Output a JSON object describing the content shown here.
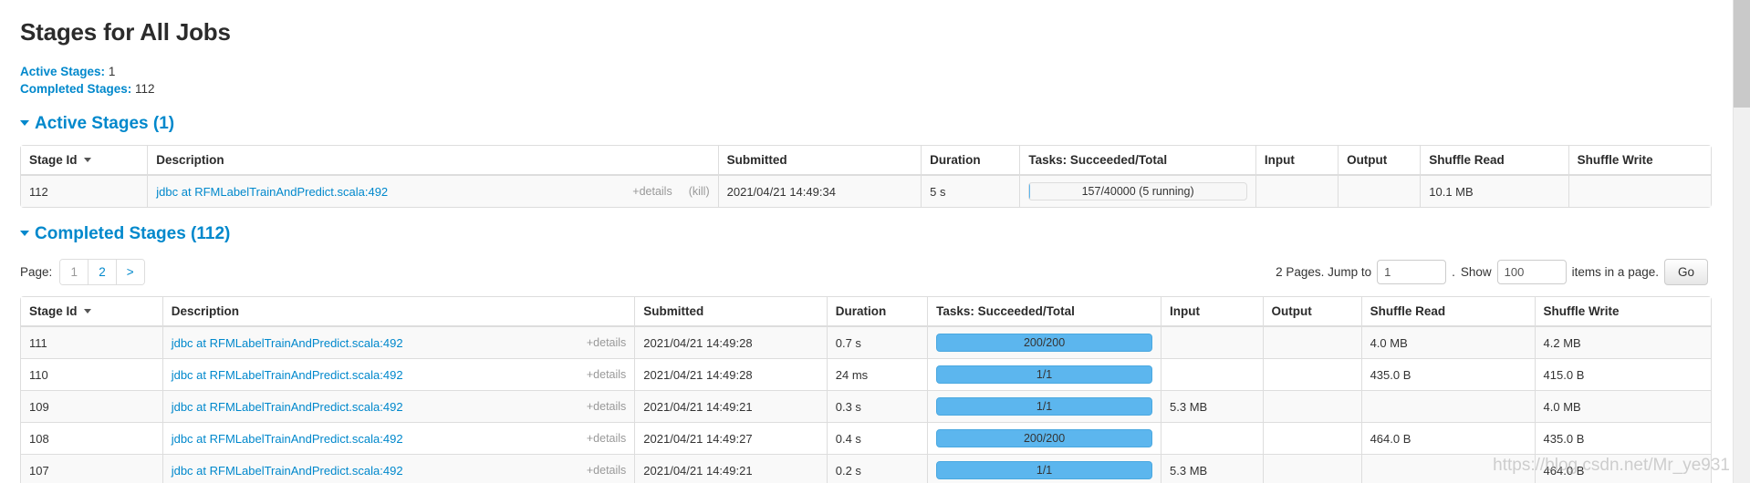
{
  "page": {
    "title": "Stages for All Jobs",
    "summary": [
      {
        "label": "Active Stages:",
        "value": "1"
      },
      {
        "label": "Completed Stages:",
        "value": "112"
      }
    ]
  },
  "active_section": {
    "header": "Active Stages (1)",
    "columns": [
      "Stage Id",
      "Description",
      "Submitted",
      "Duration",
      "Tasks: Succeeded/Total",
      "Input",
      "Output",
      "Shuffle Read",
      "Shuffle Write"
    ],
    "rows": [
      {
        "stage_id": "112",
        "description": "jdbc at RFMLabelTrainAndPredict.scala:492",
        "details_label": "+details",
        "kill_label": "(kill)",
        "submitted": "2021/04/21 14:49:34",
        "duration": "5 s",
        "tasks_label": "157/40000 (5 running)",
        "tasks_percent": 0.4,
        "tasks_complete": false,
        "input": "",
        "output": "",
        "shuffle_read": "10.1 MB",
        "shuffle_write": ""
      }
    ]
  },
  "completed_section": {
    "header": "Completed Stages (112)",
    "pager": {
      "page_label": "Page:",
      "pages": [
        "1",
        "2",
        ">"
      ],
      "current_page": "1",
      "pages_info": "2 Pages. Jump to",
      "jump_value": "1",
      "separator": ".",
      "show_label": "Show",
      "show_value": "100",
      "items_label": "items in a page.",
      "go_label": "Go"
    },
    "columns": [
      "Stage Id",
      "Description",
      "Submitted",
      "Duration",
      "Tasks: Succeeded/Total",
      "Input",
      "Output",
      "Shuffle Read",
      "Shuffle Write"
    ],
    "rows": [
      {
        "stage_id": "111",
        "description": "jdbc at RFMLabelTrainAndPredict.scala:492",
        "details_label": "+details",
        "submitted": "2021/04/21 14:49:28",
        "duration": "0.7 s",
        "tasks_label": "200/200",
        "tasks_complete": true,
        "input": "",
        "output": "",
        "shuffle_read": "4.0 MB",
        "shuffle_write": "4.2 MB"
      },
      {
        "stage_id": "110",
        "description": "jdbc at RFMLabelTrainAndPredict.scala:492",
        "details_label": "+details",
        "submitted": "2021/04/21 14:49:28",
        "duration": "24 ms",
        "tasks_label": "1/1",
        "tasks_complete": true,
        "input": "",
        "output": "",
        "shuffle_read": "435.0 B",
        "shuffle_write": "415.0 B"
      },
      {
        "stage_id": "109",
        "description": "jdbc at RFMLabelTrainAndPredict.scala:492",
        "details_label": "+details",
        "submitted": "2021/04/21 14:49:21",
        "duration": "0.3 s",
        "tasks_label": "1/1",
        "tasks_complete": true,
        "input": "5.3 MB",
        "output": "",
        "shuffle_read": "",
        "shuffle_write": "4.0 MB"
      },
      {
        "stage_id": "108",
        "description": "jdbc at RFMLabelTrainAndPredict.scala:492",
        "details_label": "+details",
        "submitted": "2021/04/21 14:49:27",
        "duration": "0.4 s",
        "tasks_label": "200/200",
        "tasks_complete": true,
        "input": "",
        "output": "",
        "shuffle_read": "464.0 B",
        "shuffle_write": "435.0 B"
      },
      {
        "stage_id": "107",
        "description": "jdbc at RFMLabelTrainAndPredict.scala:492",
        "details_label": "+details",
        "submitted": "2021/04/21 14:49:21",
        "duration": "0.2 s",
        "tasks_label": "1/1",
        "tasks_complete": true,
        "input": "5.3 MB",
        "output": "",
        "shuffle_read": "",
        "shuffle_write": "464.0 B"
      }
    ]
  },
  "watermark": {
    "text": "https://blog.csdn.net/Mr_ye931"
  },
  "colors": {
    "link": "#0088cc",
    "progress_fill": "#5cb6ee",
    "border": "#dddddd",
    "muted": "#999999"
  }
}
